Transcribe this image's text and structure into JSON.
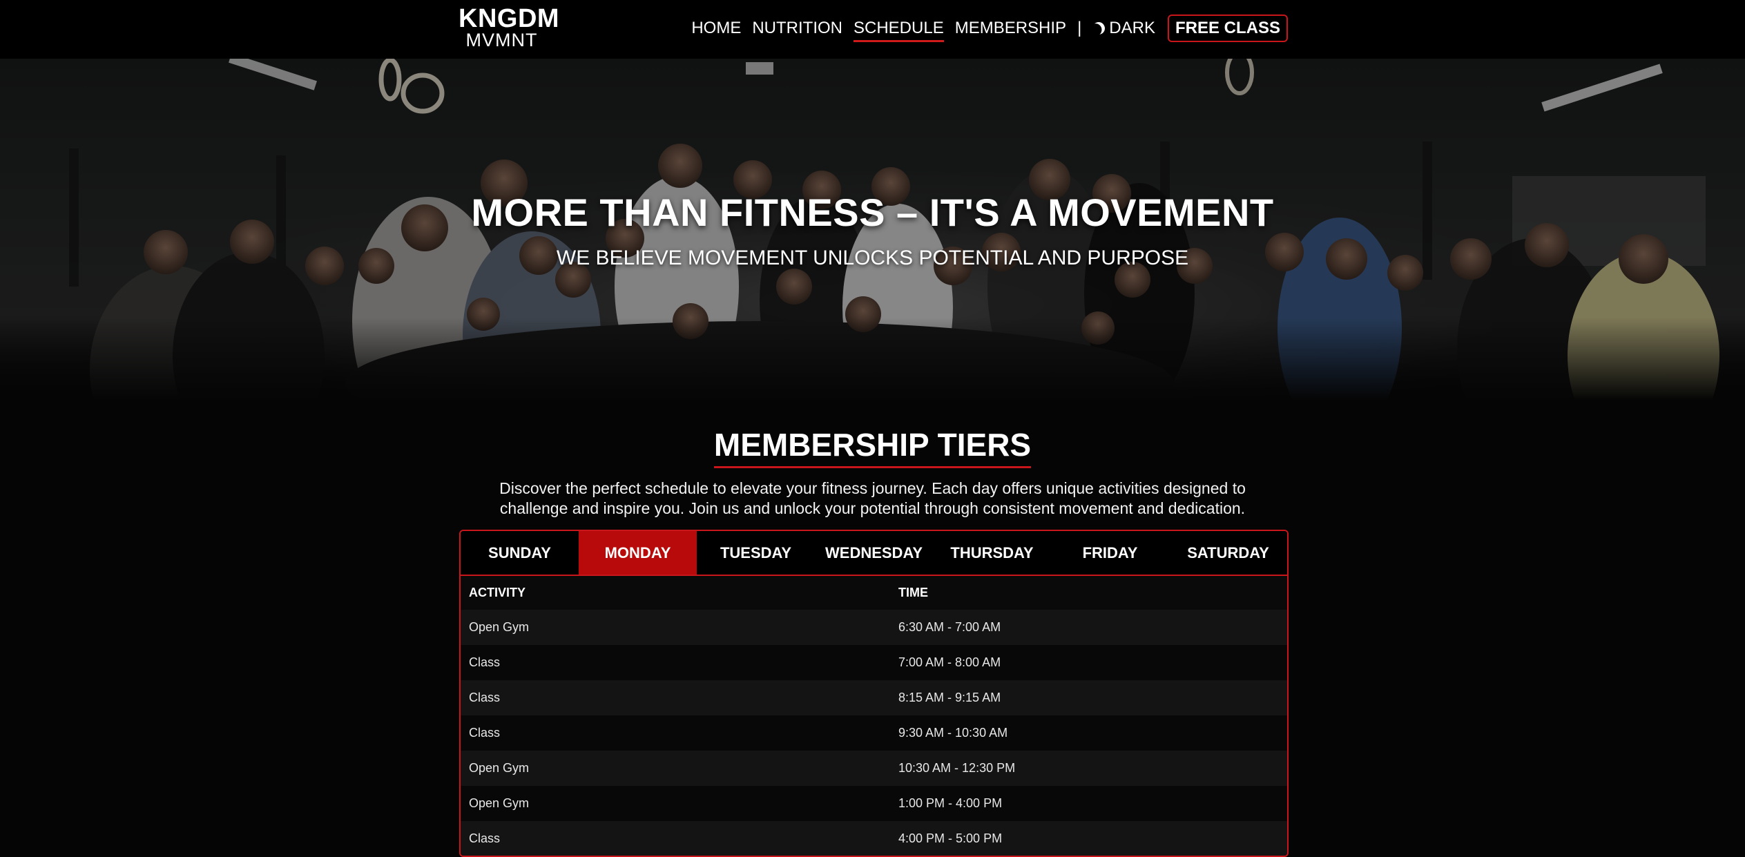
{
  "nav": {
    "logo_top": "KNGDM",
    "logo_bottom": "MVMNT",
    "links": [
      "HOME",
      "NUTRITION",
      "SCHEDULE",
      "MEMBERSHIP"
    ],
    "active_link": "SCHEDULE",
    "separator": "|",
    "dark_label": "DARK",
    "cta_label": "FREE CLASS"
  },
  "hero": {
    "title": "MORE THAN FITNESS – IT'S A MOVEMENT",
    "subtitle": "WE BELIEVE MOVEMENT UNLOCKS POTENTIAL AND PURPOSE"
  },
  "section": {
    "title": "MEMBERSHIP TIERS",
    "intro": "Discover the perfect schedule to elevate your fitness journey. Each day offers unique activities designed to challenge and inspire you. Join us and unlock your potential through consistent movement and dedication."
  },
  "schedule": {
    "tabs": [
      "SUNDAY",
      "MONDAY",
      "TUESDAY",
      "WEDNESDAY",
      "THURSDAY",
      "FRIDAY",
      "SATURDAY"
    ],
    "active_tab": "MONDAY",
    "columns": [
      "ACTIVITY",
      "TIME"
    ],
    "rows": [
      [
        "Open Gym",
        "6:30 AM - 7:00 AM"
      ],
      [
        "Class",
        "7:00 AM - 8:00 AM"
      ],
      [
        "Class",
        "8:15 AM - 9:15 AM"
      ],
      [
        "Class",
        "9:30 AM - 10:30 AM"
      ],
      [
        "Open Gym",
        "10:30 AM - 12:30 PM"
      ],
      [
        "Open Gym",
        "1:00 PM - 4:00 PM"
      ],
      [
        "Class",
        "4:00 PM - 5:00 PM"
      ]
    ]
  },
  "colors": {
    "accent": "#c8161a",
    "active_tab": "#b80a0a",
    "background": "#050505"
  }
}
